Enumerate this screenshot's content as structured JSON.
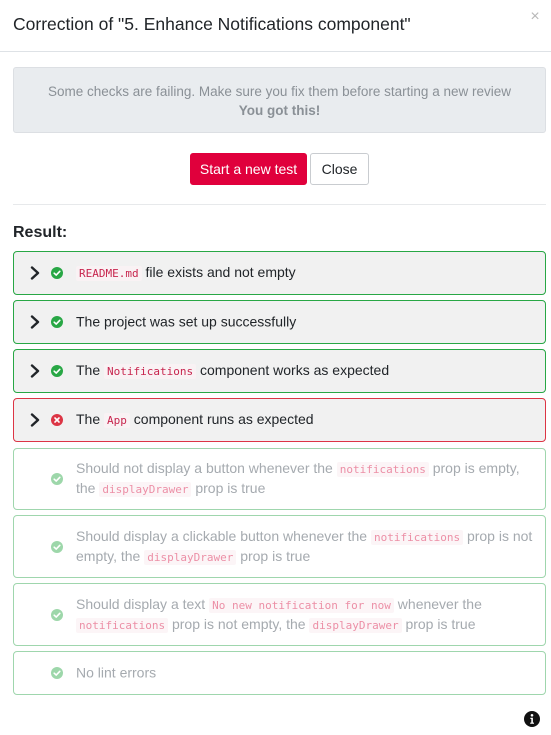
{
  "modal": {
    "title": "Correction of \"5. Enhance Notifications component\"",
    "close_glyph": "×"
  },
  "alert": {
    "message": "Some checks are failing. Make sure you fix them before starting a new review",
    "emphasis": "You got this!"
  },
  "actions": {
    "start_label": "Start a new test",
    "close_label": "Close"
  },
  "result": {
    "heading": "Result:",
    "checks": [
      {
        "status": "pass",
        "pre": "",
        "code": "README.md",
        "post": " file exists and not empty"
      },
      {
        "status": "pass",
        "pre": "The project was set up successfully",
        "code": "",
        "post": ""
      },
      {
        "status": "pass",
        "pre": "The ",
        "code": "Notifications",
        "post": " component works as expected"
      },
      {
        "status": "fail",
        "pre": "The ",
        "code": "App",
        "post": " component runs as expected"
      }
    ],
    "subchecks": [
      {
        "t1": "Should not display a button whenever the ",
        "c1": "notifications",
        "t2": " prop is empty, the ",
        "c2": "displayDrawer",
        "t3": " prop is true"
      },
      {
        "t1": "Should display a clickable button whenever the ",
        "c1": "notifications",
        "t2": " prop is not empty, the ",
        "c2": "displayDrawer",
        "t3": " prop is true"
      },
      {
        "t1": "Should display a text ",
        "c1": "No new notification for now",
        "t2": " whenever the ",
        "c2": "notifications",
        "t3": " prop is not empty, the ",
        "c3": "displayDrawer",
        "t4": " prop is true"
      },
      {
        "t1": "No lint errors"
      }
    ]
  },
  "colors": {
    "accent": "#e0003c",
    "pass": "#28a745",
    "fail": "#dc3545"
  },
  "icons": {
    "pass": "check-circle-icon",
    "fail": "times-circle-icon",
    "expand": "chevron-right-icon",
    "info": "info-circle-icon"
  }
}
